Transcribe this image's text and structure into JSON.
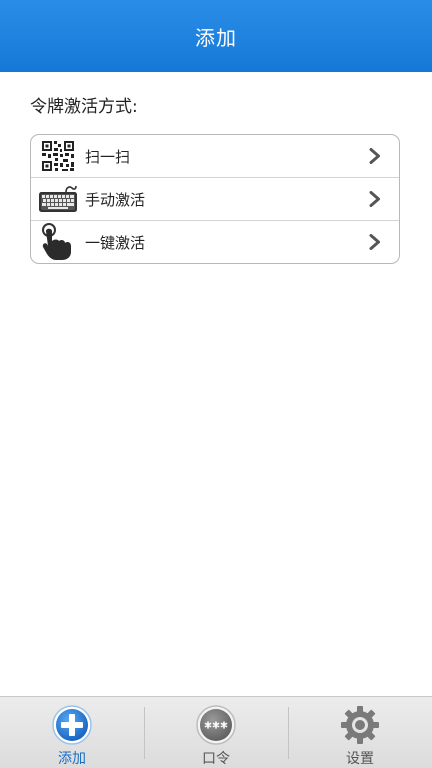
{
  "header": {
    "title": "添加"
  },
  "section": {
    "label": "令牌激活方式:"
  },
  "menu": {
    "items": [
      {
        "label": "扫一扫",
        "icon": "qr-code-icon"
      },
      {
        "label": "手动激活",
        "icon": "keyboard-icon"
      },
      {
        "label": "一键激活",
        "icon": "hand-tap-icon"
      }
    ]
  },
  "tabbar": {
    "tabs": [
      {
        "label": "添加",
        "icon": "plus-circle-icon",
        "active": true
      },
      {
        "label": "口令",
        "icon": "password-dots-icon",
        "active": false
      },
      {
        "label": "设置",
        "icon": "gear-icon",
        "active": false
      }
    ]
  },
  "colors": {
    "header": "#1a82e0",
    "active_tab": "#1a6fc4"
  }
}
